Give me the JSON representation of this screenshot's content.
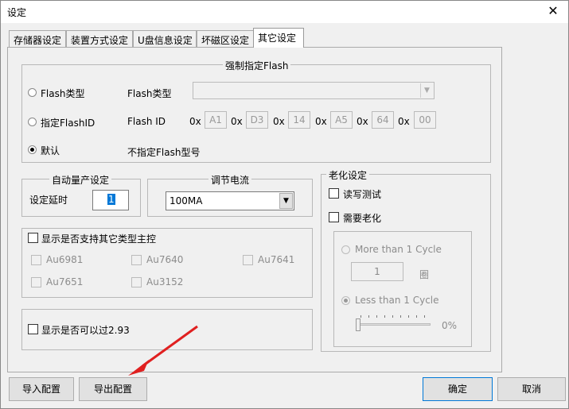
{
  "window": {
    "title": "设定",
    "close_glyph": "✕"
  },
  "tabs": [
    {
      "label": "存储器设定",
      "active": false
    },
    {
      "label": "装置方式设定",
      "active": false
    },
    {
      "label": "U盘信息设定",
      "active": false
    },
    {
      "label": "坏磁区设定",
      "active": false
    },
    {
      "label": "其它设定",
      "active": true
    }
  ],
  "flash_group": {
    "title": "强制指定Flash",
    "radio_flash_type": {
      "label": "Flash类型",
      "checked": false
    },
    "flash_type_label": "Flash类型",
    "flash_type_value": "",
    "radio_flash_id": {
      "label": "指定FlashID",
      "checked": false
    },
    "flash_id_label": "Flash  ID",
    "hex_prefix": "0x",
    "flash_id_bytes": [
      "A1",
      "D3",
      "14",
      "A5",
      "64",
      "00"
    ],
    "radio_default": {
      "label": "默认",
      "checked": true
    },
    "default_note": "不指定Flash型号"
  },
  "auto_mass": {
    "title": "自动量产设定",
    "delay_label": "设定延时",
    "delay_value": "1"
  },
  "current": {
    "title": "调节电流",
    "value": "100MA",
    "arrow": "▼"
  },
  "support_group": {
    "label": "显示是否支持其它类型主控",
    "checked": false,
    "items": [
      "Au6981",
      "Au7640",
      "Au7641",
      "Au7651",
      "Au3152"
    ]
  },
  "pass293": {
    "label": "显示是否可以过2.93",
    "checked": false
  },
  "aging": {
    "title": "老化设定",
    "rw_test": {
      "label": "读写测试",
      "checked": false
    },
    "need_aging": {
      "label": "需要老化",
      "checked": false
    },
    "more_than": {
      "label": "More than 1 Cycle",
      "checked": false
    },
    "cycles_value": "1",
    "cycles_unit": "圈",
    "less_than": {
      "label": "Less than 1 Cycle",
      "checked": true
    },
    "percent": 0,
    "percent_label": "0%"
  },
  "buttons": {
    "import": "导入配置",
    "export": "导出配置",
    "ok": "确定",
    "cancel": "取消"
  },
  "colors": {
    "annotation_arrow": "#e02020",
    "window_bg": "#f0f0f0"
  }
}
